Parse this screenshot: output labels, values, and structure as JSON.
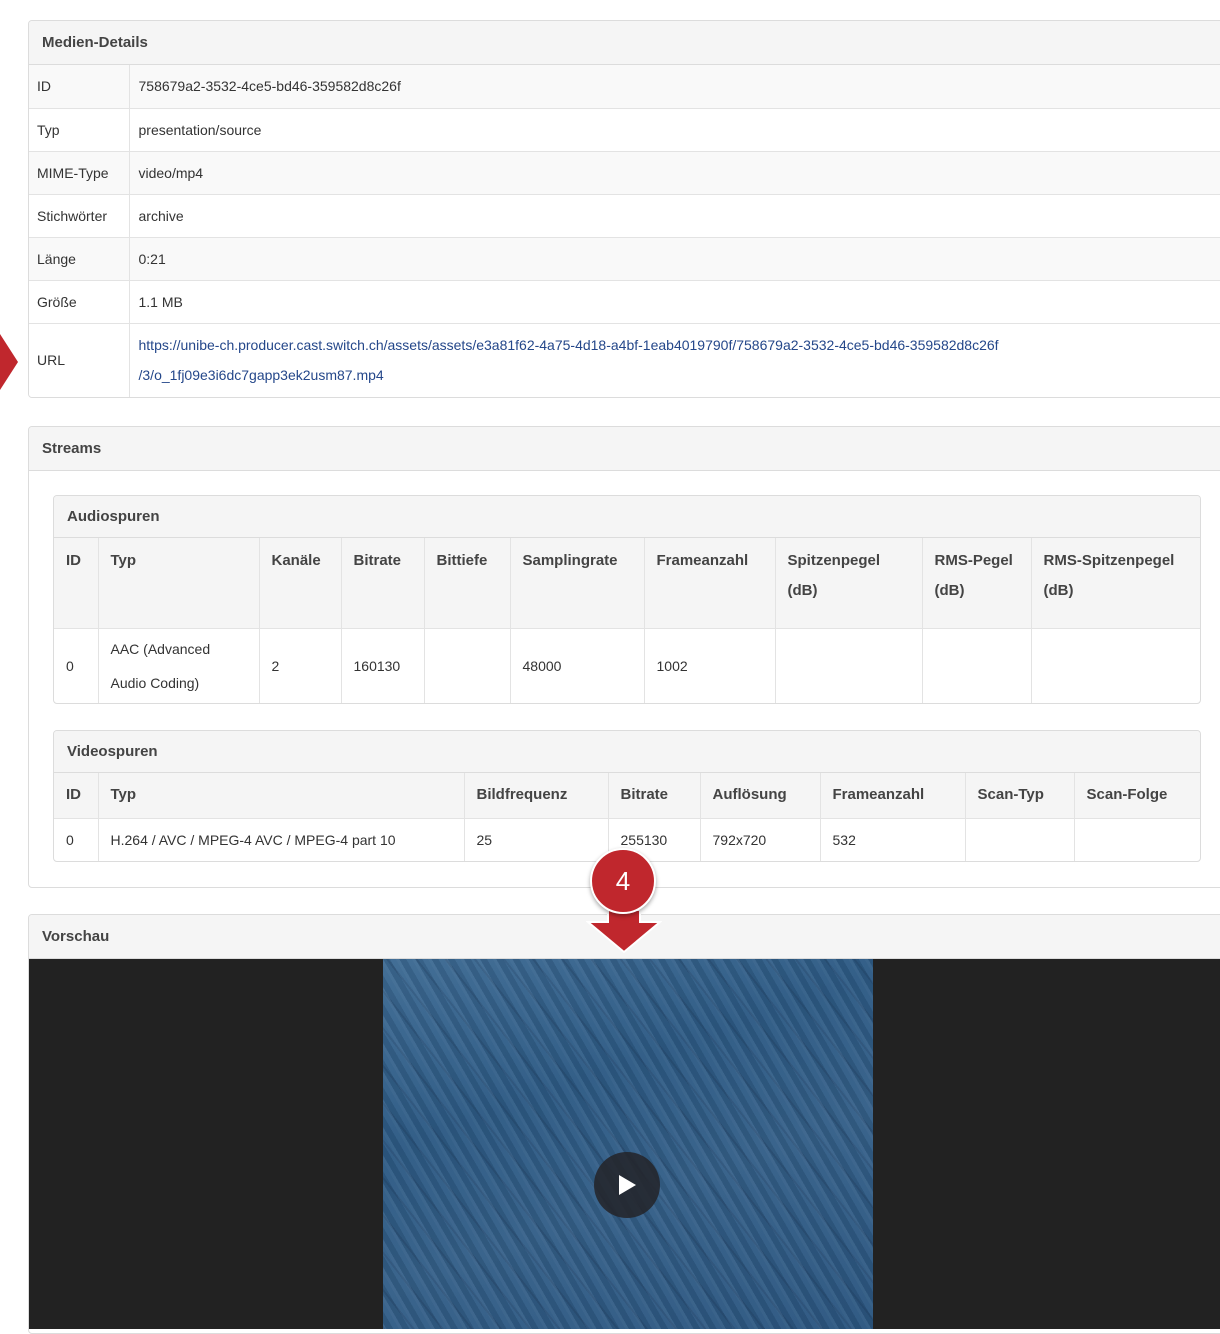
{
  "details": {
    "title": "Medien-Details",
    "rows": [
      {
        "key": "ID",
        "value": "758679a2-3532-4ce5-bd46-359582d8c26f"
      },
      {
        "key": "Typ",
        "value": "presentation/source"
      },
      {
        "key": "MIME-Type",
        "value": "video/mp4"
      },
      {
        "key": "Stichwörter",
        "value": "archive"
      },
      {
        "key": "Länge",
        "value": "0:21"
      },
      {
        "key": "Größe",
        "value": "1.1 MB"
      }
    ],
    "url_key": "URL",
    "url_line1": "https://unibe-ch.producer.cast.switch.ch/assets/assets/e3a81f62-4a75-4d18-a4bf-1eab4019790f/758679a2-3532-4ce5-bd46-359582d8c26f",
    "url_line2": "/3/o_1fj09e3i6dc7gapp3ek2usm87.mp4"
  },
  "streams": {
    "title": "Streams",
    "audio": {
      "title": "Audiospuren",
      "headers": [
        "ID",
        "Typ",
        "Kanäle",
        "Bitrate",
        "Bittiefe",
        "Samplingrate",
        "Frameanzahl",
        "Spitzenpegel (dB)",
        "RMS-Pegel (dB)",
        "RMS-Spitzenpegel (dB)"
      ],
      "row": [
        "0",
        "AAC (Advanced Audio Coding)",
        "2",
        "160130",
        "",
        "48000",
        "1002",
        "",
        "",
        ""
      ]
    },
    "video": {
      "title": "Videospuren",
      "headers": [
        "ID",
        "Typ",
        "Bildfrequenz",
        "Bitrate",
        "Auflösung",
        "Frameanzahl",
        "Scan-Typ",
        "Scan-Folge"
      ],
      "row": [
        "0",
        "H.264 / AVC / MPEG-4 AVC / MPEG-4 part 10",
        "25",
        "255130",
        "792x720",
        "532",
        "",
        ""
      ]
    }
  },
  "preview": {
    "title": "Vorschau"
  },
  "annotation": {
    "step": "4",
    "color": "#c0272d"
  },
  "icons": {
    "play": "play-icon"
  }
}
